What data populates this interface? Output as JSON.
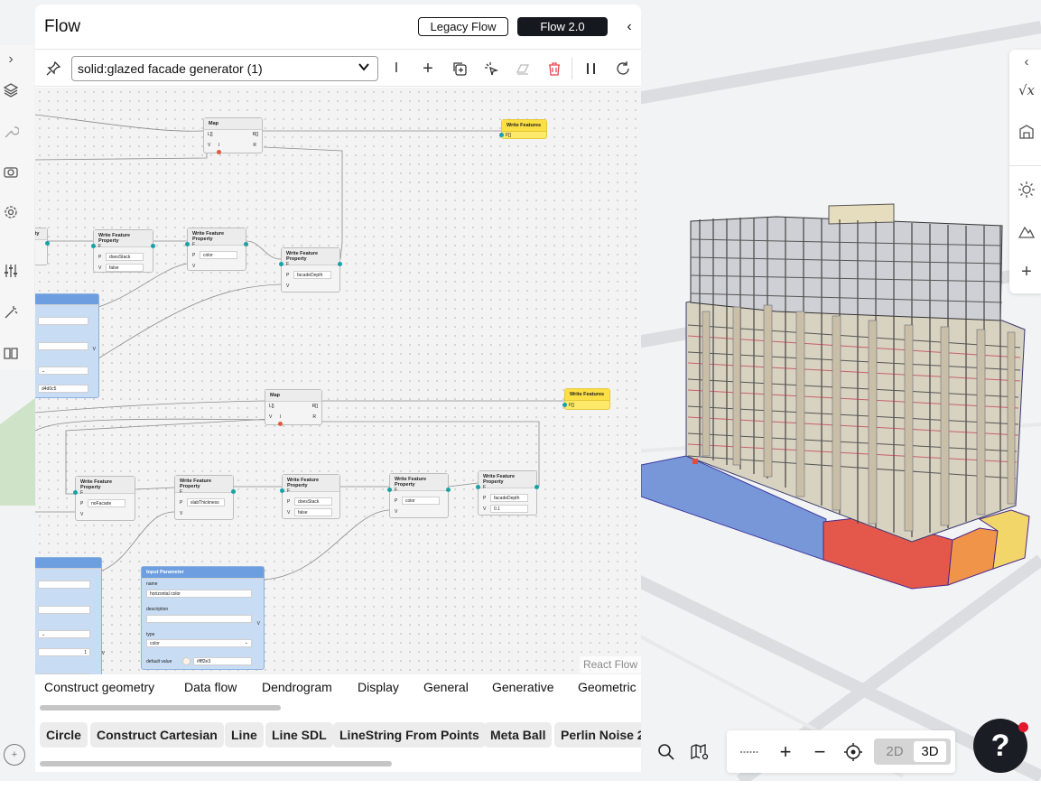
{
  "flow_panel": {
    "title": "Flow",
    "legacy_button": "Legacy Flow",
    "flow2_button": "Flow 2.0",
    "selected_flow": "solid:glazed facade generator (1)",
    "react_flow_label": "React Flow"
  },
  "nodes": {
    "map1": {
      "title": "Map",
      "in_l": "L[]",
      "out_r": "R[]",
      "v": "V",
      "i": "I",
      "r": "R"
    },
    "map2": {
      "title": "Map",
      "in_l": "L[]",
      "out_r": "R[]",
      "v": "V",
      "i": "I",
      "r": "R"
    },
    "write_features1": {
      "title": "Write Features",
      "port": "F[]"
    },
    "write_features2": {
      "title": "Write Features",
      "port": "F[]"
    },
    "partial_top": {
      "title": "perty"
    },
    "wfp_a": {
      "title": "Write Feature Property",
      "f": "F",
      "p": "P",
      "v": "V",
      "value": "doesStack",
      "value2": "false"
    },
    "wfp_b": {
      "title": "Write Feature Property",
      "f": "F",
      "p": "P",
      "v": "V",
      "value": "color"
    },
    "wfp_c": {
      "title": "Write Feature Property",
      "f": "F",
      "p": "P",
      "v": "V",
      "value": "facadeDepth"
    },
    "wfp_d": {
      "title": "Write Feature Property",
      "f": "F",
      "p": "P",
      "v": "V",
      "value": "noFacade"
    },
    "wfp_e": {
      "title": "Write Feature Property",
      "f": "F",
      "p": "P",
      "v": "V",
      "value": "slabThickness"
    },
    "wfp_f": {
      "title": "Write Feature Property",
      "f": "F",
      "p": "P",
      "v": "V",
      "value": "doesStack",
      "value2": "false"
    },
    "wfp_g": {
      "title": "Write Feature Property",
      "f": "F",
      "p": "P",
      "v": "V",
      "value": "color"
    },
    "wfp_h": {
      "title": "Write Feature Property",
      "f": "F",
      "p": "P",
      "v": "V",
      "value": "facadeDepth",
      "value2": "0.1"
    },
    "blue_partial_1": {
      "value": "d4d0c5",
      "v": "V"
    },
    "blue_partial_2": {
      "value": "1",
      "value2": "1",
      "v": "V"
    },
    "input_param": {
      "title": "Input Parameter",
      "name_label": "name",
      "name_value": "horizontal color",
      "description_label": "description",
      "type_label": "type",
      "type_value": "color",
      "default_label": "default value",
      "default_value": "#fff2e3",
      "v": "V"
    }
  },
  "category_tabs": [
    "Construct geometry",
    "Data flow",
    "Dendrogram",
    "Display",
    "General",
    "Generative",
    "Geometric"
  ],
  "node_chips": [
    "Circle",
    "Construct Cartesian",
    "Line",
    "Line SDL",
    "LineString From Points",
    "Meta Ball",
    "Perlin Noise 2"
  ],
  "map_controls": {
    "mode_2d": "2D",
    "mode_3d": "3D",
    "active_mode": "3D"
  },
  "icons": {
    "left_rail": [
      "chevron-right-icon",
      "layers-icon",
      "wrench-icon",
      "camera-icon",
      "gear-icon",
      "sliders-icon",
      "magic-icon",
      "book-icon"
    ],
    "right_rail": [
      "chevron-left-icon",
      "formula-icon",
      "building-icon",
      "sun-icon",
      "terrain-icon",
      "plus-icon"
    ]
  },
  "colors": {
    "accent_dark": "#15191f",
    "node_yellow": "#fde96a",
    "node_blue": "#6d9ee0",
    "podium_blue": "#6f8fd6",
    "podium_red": "#e4584c",
    "podium_orange": "#f0944a",
    "podium_yellow": "#f3d66a",
    "help_badge": "#e3192d"
  }
}
